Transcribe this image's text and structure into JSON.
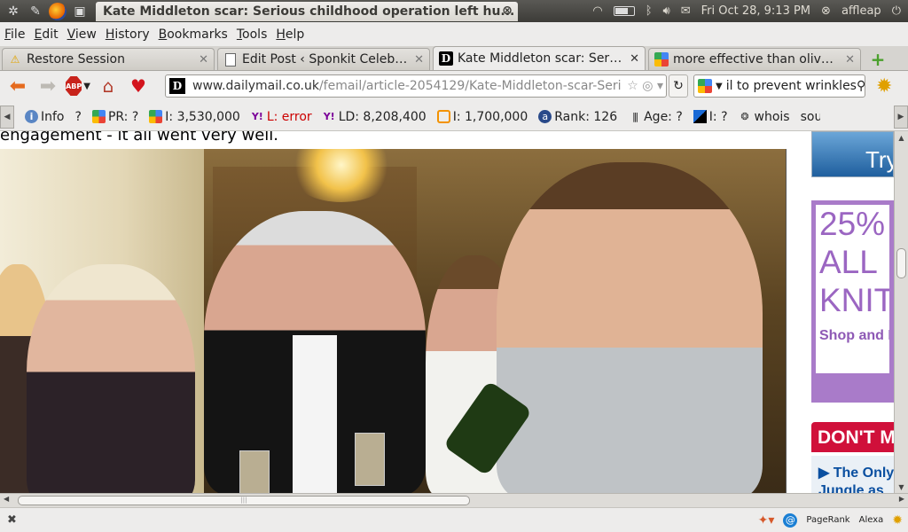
{
  "panel": {
    "window_title": "Kate Middleton scar: Serious childhood operation left hu...",
    "datetime": "Fri Oct 28,  9:13 PM",
    "user": "affleap"
  },
  "menu": [
    "File",
    "Edit",
    "View",
    "History",
    "Bookmarks",
    "Tools",
    "Help"
  ],
  "tabs": [
    {
      "label": "Restore Session",
      "icon": "warning-icon",
      "active": false
    },
    {
      "label": "Edit Post ‹ Sponkit Celebrit...",
      "icon": "page-icon",
      "active": false
    },
    {
      "label": "Kate Middleton scar: Seriou...",
      "icon": "dailymail-icon",
      "active": true
    },
    {
      "label": "more effective than olive o...",
      "icon": "google-icon",
      "active": false
    }
  ],
  "nav": {
    "url_host": "www.dailymail.co.uk",
    "url_path": "/femail/article-2054129/Kate-Middleton-scar-Seri",
    "search_value": "il to prevent wrinkles"
  },
  "seo": {
    "info": "Info",
    "question": "?",
    "pr": "PR: ?",
    "google_index": "I: 3,530,000",
    "yahoo_links": "L: error",
    "yahoo_ld": "LD: 8,208,400",
    "bing_index": "I: 1,700,000",
    "rank": "Rank: 126",
    "age": "Age: ?",
    "del_index": "I: ?",
    "whois": "whois",
    "more": "sou"
  },
  "content": {
    "caption": "engagement - it all went very well."
  },
  "ads": {
    "top": "Try",
    "knit_line1": "25%",
    "knit_line2": "ALL",
    "knit_line3": "KNIT",
    "knit_shop": "Shop and K",
    "dont": "DON'T M",
    "only_line1": "▶ The Only",
    "only_line2": "Jungle as"
  },
  "status": {
    "pagerank": "PageRank",
    "alexa": "Alexa"
  }
}
